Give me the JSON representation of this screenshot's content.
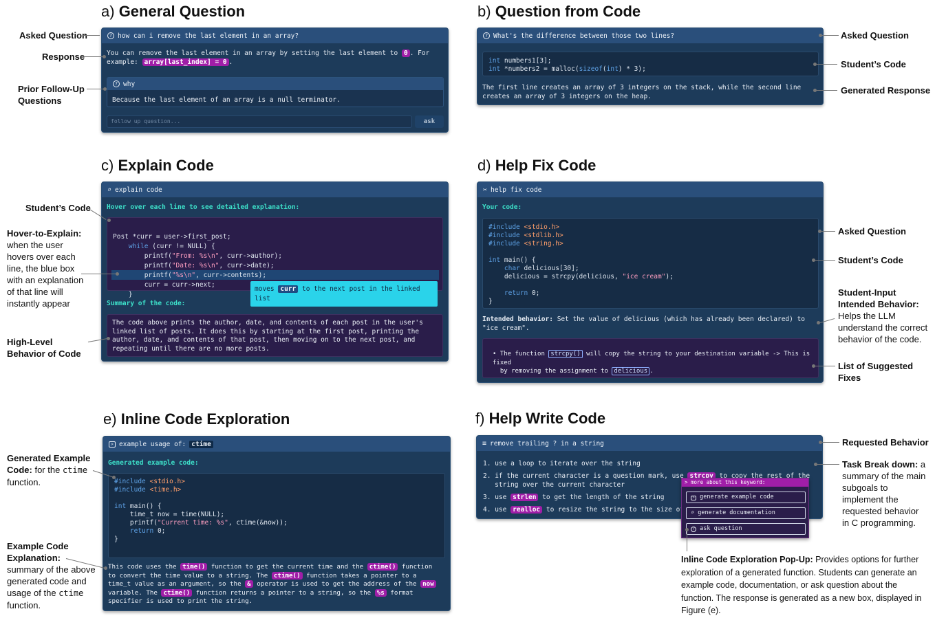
{
  "sections": {
    "a": {
      "letter": "a)",
      "title": "General Question"
    },
    "b": {
      "letter": "b)",
      "title": "Question from Code"
    },
    "c": {
      "letter": "c)",
      "title": "Explain Code"
    },
    "d": {
      "letter": "d)",
      "title": "Help Fix Code"
    },
    "e": {
      "letter": "e)",
      "title": "Inline Code Exploration"
    },
    "f": {
      "letter": "f)",
      "title": "Help Write Code"
    }
  },
  "panel_a": {
    "question": "how can i remove the last element in an array?",
    "response_text": "You can remove the last element in an array by setting the last element to",
    "response_val": "0",
    "response_text2": ". For",
    "response_line2": "example:",
    "response_code": "array[last_index] = 0",
    "followup_q": "why",
    "followup_answer": "Because the last element of an array is a null terminator.",
    "input_placeholder": "follow up question...",
    "ask_label": "ask"
  },
  "panel_b": {
    "question": "What's the difference between those two lines?",
    "code_line1_kw": "int",
    "code_line1": " numbers1[3];",
    "code_line2_kw": "int",
    "code_line2a": " *numbers2 = malloc(",
    "code_line2_fn": "sizeof",
    "code_line2b": "(",
    "code_line2_kw2": "int",
    "code_line2c": ") * 3);",
    "response": "The first line creates an array of 3 integers on the stack, while the second line creates an array of 3 integers on the heap."
  },
  "panel_c": {
    "header": "explain code",
    "hover_hint": "Hover over each line to see detailed explanation:",
    "code_lines": [
      "Post *curr = user->first_post;",
      "    while (curr != NULL) {",
      "        printf(\"From: %s\\n\", curr->author);",
      "        printf(\"Date: %s\\n\", curr->date);",
      "        printf(\"%s\\n\", curr->contents);",
      "        curr = curr->next;",
      "    }"
    ],
    "tooltip_pre": "moves",
    "tooltip_code": "curr",
    "tooltip_post": "to the next post in the linked list",
    "summary_title": "Summary of the code:",
    "summary": "The code above prints the author, date, and contents of each post in the user's linked list of posts. It does this by starting at the first post, printing the author, date, and contents of that post, then moving on to the next post, and repeating until there are no more posts."
  },
  "panel_d": {
    "header": "help fix code",
    "your_code": "Your code:",
    "includes": [
      "#include <stdio.h>",
      "#include <stdlib.h>",
      "#include <string.h>"
    ],
    "main_sig": "int main() {",
    "decl": "    char delicious[30];",
    "assign_pre": "    delicious = strcpy(delicious, ",
    "assign_str": "\"ice cream\"",
    "assign_post": ");",
    "ret": "    return 0;",
    "close": "}",
    "intended_label": "Intended behavior:",
    "intended_text": "Set the value of delicious (which has already been declared) to \"ice cream\".",
    "fix_pre": "The function",
    "fix_fn": "strcpy()",
    "fix_mid": "will copy the string to your destination variable -> This is",
    "fix_fixed": "fixed",
    "fix_line2": "by removing the assignment to",
    "fix_var": "delicious",
    "fix_end": "."
  },
  "panel_e": {
    "header_pre": "example usage of:",
    "header_fn": "ctime",
    "gen_title": "Generated example code:",
    "code_lines": [
      "#include <stdio.h>",
      "#include <time.h>",
      "",
      "int main() {",
      "    time_t now = time(NULL);",
      "    printf(\"Current time: %s\", ctime(&now));",
      "    return 0;",
      "}"
    ],
    "explanation": {
      "t1": "This code uses the",
      "p1": "time()",
      "t2": "function to get the current time and the",
      "p2": "ctime()",
      "t3": "function",
      "t4": "to convert the time value to a string. The",
      "p3": "ctime()",
      "t5": "function takes a pointer to a",
      "t6": "time_t value as an argument, so the",
      "p4": "&",
      "t7": "operator is used to get the address of the",
      "p5": "now",
      "t8": "variable. The",
      "p6": "ctime()",
      "t9": "function returns a pointer to a string, so the",
      "p7": "%s",
      "t10": "format",
      "t11": "specifier is used to print the string."
    }
  },
  "panel_f": {
    "header": "remove trailing ? in a string",
    "steps": [
      {
        "n": "1.",
        "pre": "use a loop to iterate over the string",
        "pill": "",
        "post": ""
      },
      {
        "n": "2.",
        "pre": "if the current character is a question mark, use",
        "pill": "strcpy",
        "post": "to copy the rest of the",
        "line2": "string over the current character"
      },
      {
        "n": "3.",
        "pre": "use",
        "pill": "strlen",
        "post": "to get the length of the string"
      },
      {
        "n": "4.",
        "pre": "use",
        "pill": "realloc",
        "post": "to resize the string to the size of"
      }
    ],
    "popup_title": "> more about this keyword:",
    "popup_options": [
      "generate example code",
      "generate documentation",
      "ask question"
    ]
  },
  "annotations": {
    "a_asked": "Asked Question",
    "a_response": "Response",
    "a_prior": "Prior  Follow-Up",
    "a_prior2": "Questions",
    "b_asked": "Asked Question",
    "b_code": "Student’s Code",
    "b_response": "Generated Response",
    "c_code": "Student’s Code",
    "c_hover_bold": "Hover-to-Explain:",
    "c_hover_rest": "when the user hovers over each line, the blue box with an explanation of that line will instantly appear",
    "c_high": "High-Level Behavior of Code",
    "d_asked": "Asked Question",
    "d_code": "Student’s Code",
    "d_intended_bold": "Student-Input Intended Behavior:",
    "d_intended_rest": "Helps the LLM understand the correct behavior of the code.",
    "d_fixes": "List of Suggested Fixes",
    "e_gen_bold": "Generated Example Code:",
    "e_gen_rest1": "for the",
    "e_gen_code": "ctime",
    "e_gen_rest2": "function.",
    "e_expl_bold": "Example Code Explanation:",
    "e_expl_rest1": "summary of the above generated code and usage of the",
    "e_expl_code": "ctime",
    "e_expl_rest2": "function.",
    "f_requested": "Requested Behavior",
    "f_task_bold": "Task Break down:",
    "f_task_rest": "a summary of the main subgoals to implement the requested behavior in C programming.",
    "f_popup_bold": "Inline Code Exploration Pop-Up:",
    "f_popup_rest": "Provides options for further exploration of a generated function. Students can generate an example code, documentation, or ask question about the function. The response is generated as a new box, displayed in Figure (e)."
  },
  "colors": {
    "panel_bg": "#1d3b5a",
    "header_bg": "#2a4f7b",
    "accent_green": "#3de0c9",
    "pill_magenta": "#a01ea8",
    "tooltip_cyan": "#2ad3ea"
  }
}
